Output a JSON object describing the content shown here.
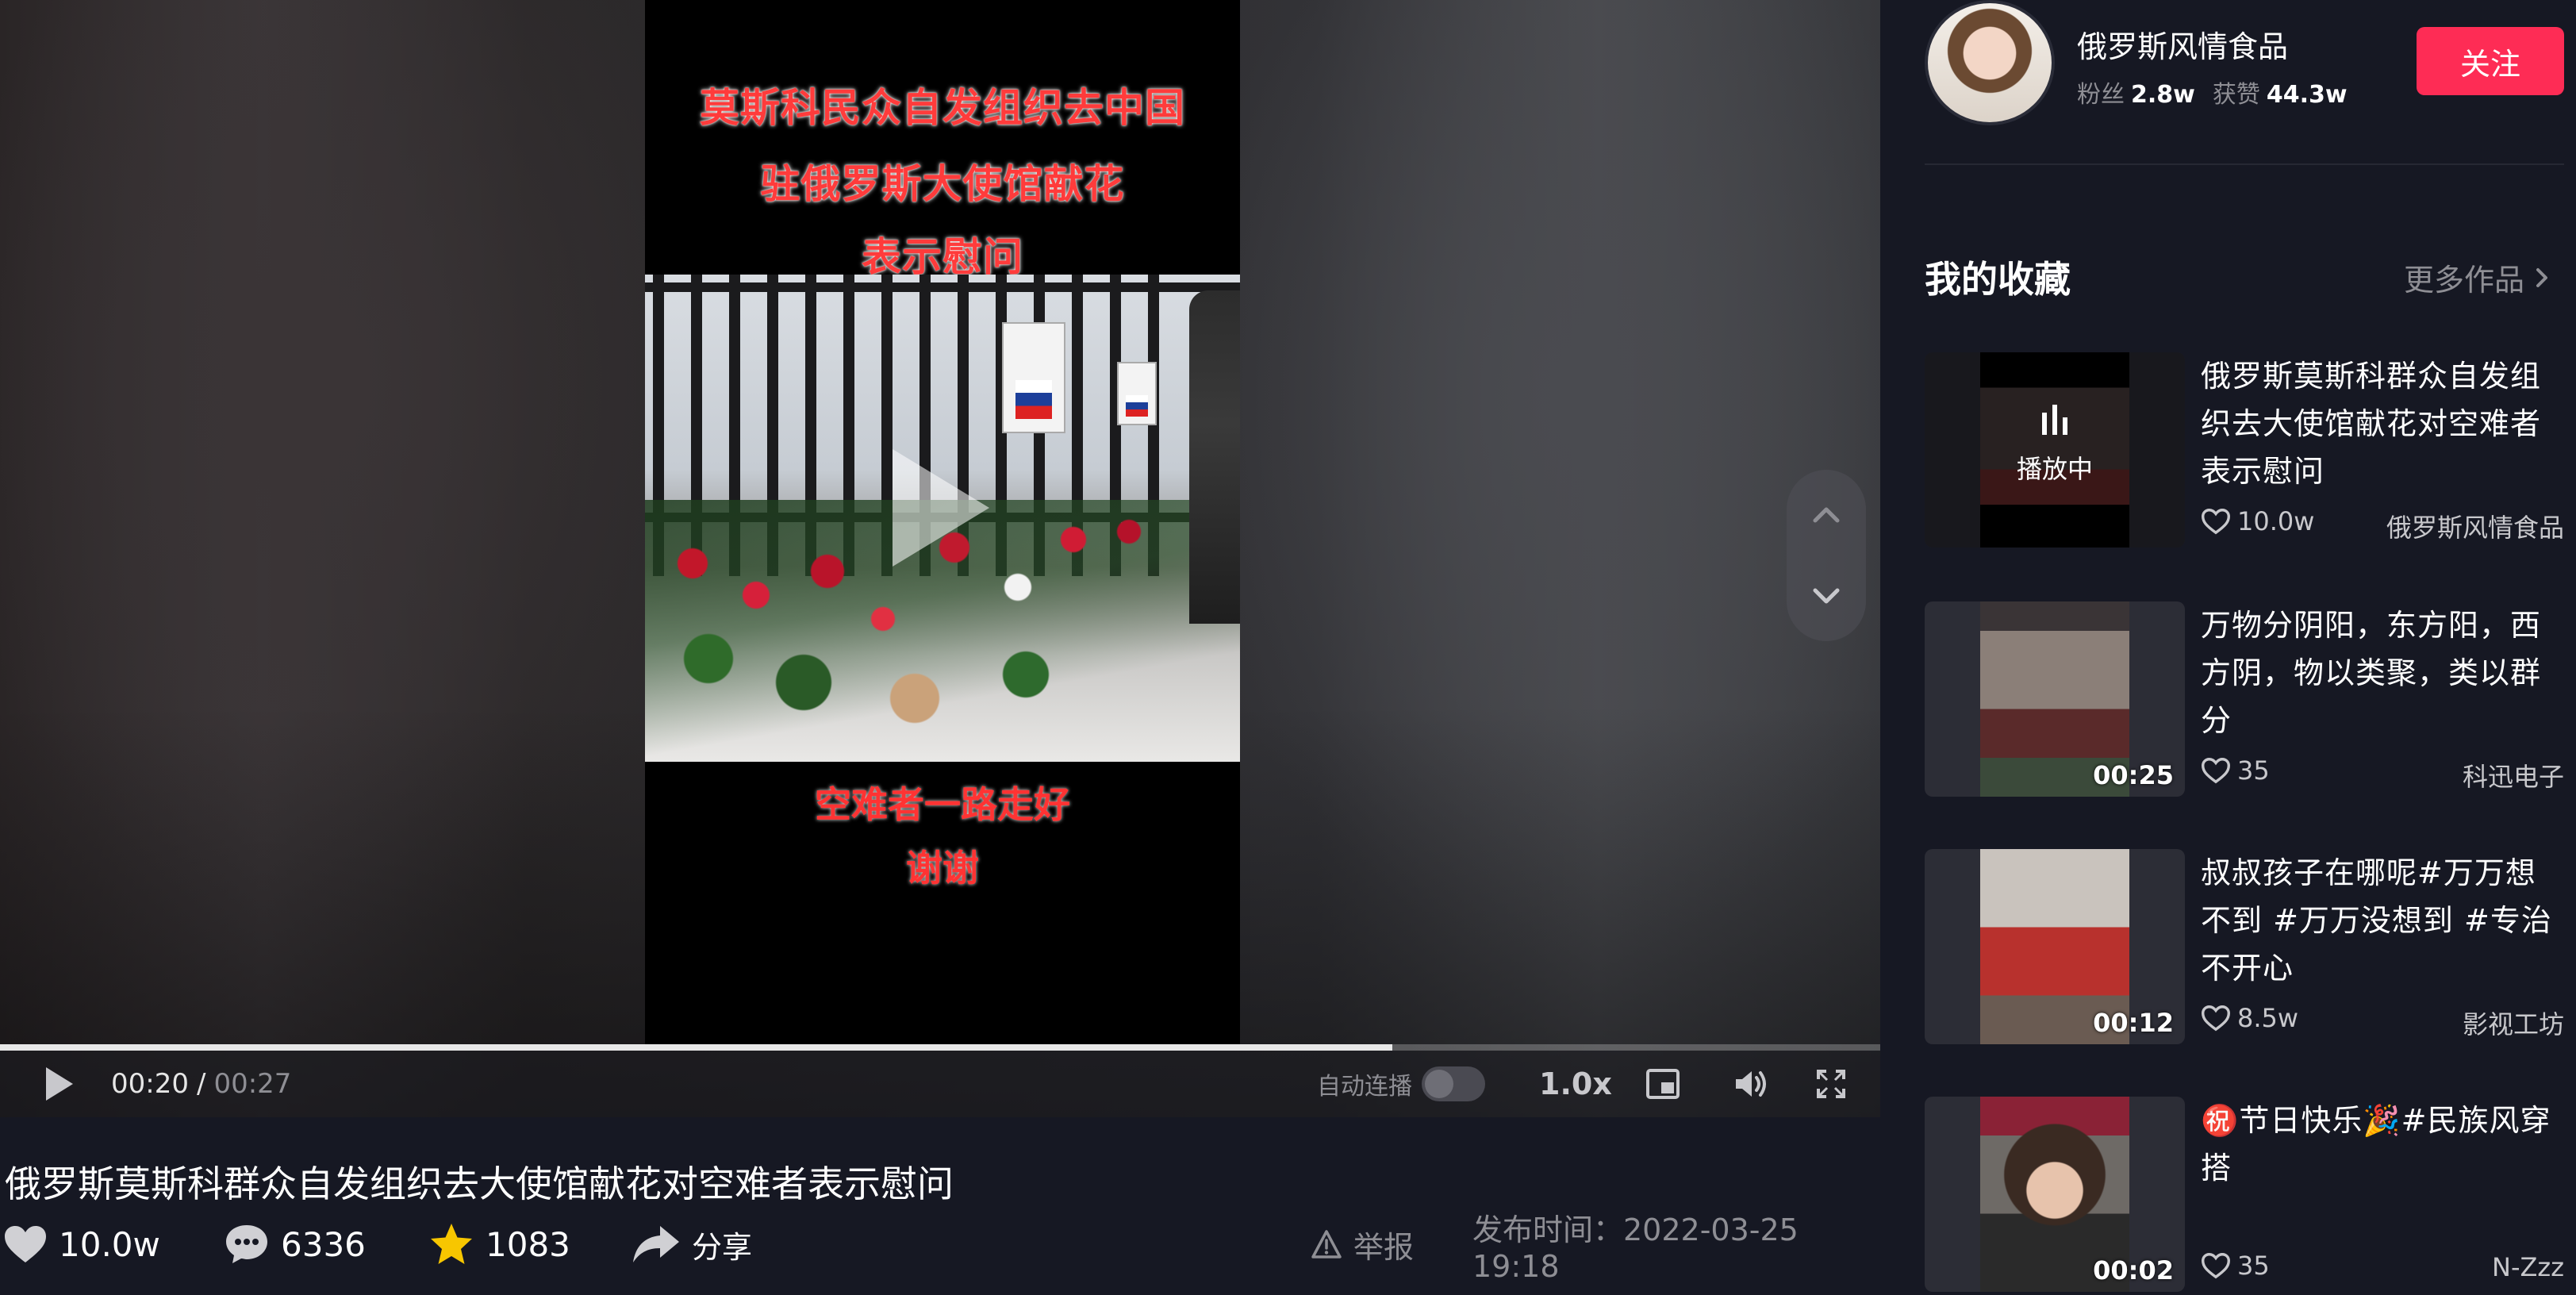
{
  "video": {
    "overlay_title_lines": [
      "莫斯科民众自发组织去中国",
      "驻俄罗斯大使馆献花",
      "表示慰问"
    ],
    "overlay_caption_lines": [
      "空难者一路走好",
      "谢谢"
    ],
    "progress_fraction": 0.7407
  },
  "controls": {
    "time_current": "00:20",
    "time_separator": "/",
    "time_total": "00:27",
    "autoplay_label": "自动连播",
    "speed": "1.0x"
  },
  "info": {
    "title": "俄罗斯莫斯科群众自发组织去大使馆献花对空难者表示慰问",
    "likes": "10.0w",
    "comments": "6336",
    "favorites": "1083",
    "share_label": "分享",
    "report_label": "举报",
    "publish_time": "发布时间：2022-03-25 19:18"
  },
  "author": {
    "name": "俄罗斯风情食品",
    "fans_label": "粉丝",
    "fans": "2.8w",
    "likes_label": "获赞",
    "likes": "44.3w",
    "follow_label": "关注"
  },
  "collection": {
    "title": "我的收藏",
    "more_label": "更多作品",
    "items": [
      {
        "title": "俄罗斯莫斯科群众自发组织去大使馆献花对空难者表示慰问",
        "badge": "播放中",
        "duration": "",
        "likes": "10.0w",
        "author": "俄罗斯风情食品"
      },
      {
        "title": "万物分阴阳，东方阳，西方阴，物以类聚，类以群分",
        "badge": "",
        "duration": "00:25",
        "likes": "35",
        "author": "科迅电子"
      },
      {
        "title": "叔叔孩子在哪呢#万万想不到 #万万没想到 #专治不开心",
        "badge": "",
        "duration": "00:12",
        "likes": "8.5w",
        "author": "影视工坊"
      },
      {
        "title": "㊗️节日快乐🎉#民族风穿搭",
        "badge": "",
        "duration": "00:02",
        "likes": "35",
        "author": "N-Zzz"
      }
    ]
  },
  "colors": {
    "accent": "#fe2c55",
    "background": "#161823",
    "overlay_red": "#ff3b3b"
  },
  "icons": [
    "play-icon",
    "fullscreen-icon",
    "volume-icon",
    "pip-icon",
    "heart-icon",
    "comment-icon",
    "star-icon",
    "share-icon",
    "warning-icon",
    "chevron-up-icon",
    "chevron-down-icon",
    "chevron-right-icon",
    "playing-bars-icon"
  ]
}
